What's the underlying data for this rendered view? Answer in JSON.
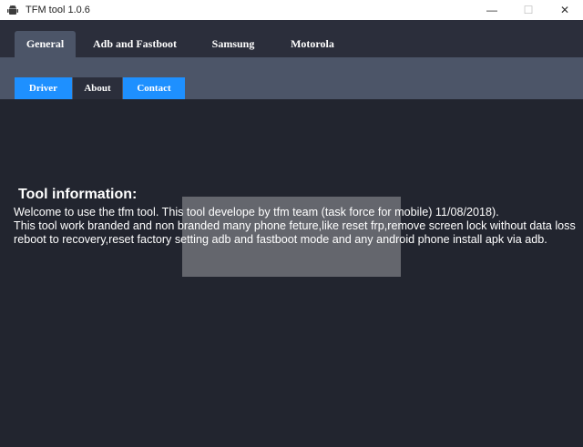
{
  "window": {
    "title": "TFM tool 1.0.6",
    "minimize_label": "—",
    "maximize_label": "☐",
    "close_label": "✕"
  },
  "main_tabs": [
    {
      "label": "General",
      "active": true
    },
    {
      "label": "Adb and Fastboot",
      "active": false
    },
    {
      "label": "Samsung",
      "active": false
    },
    {
      "label": "Motorola",
      "active": false
    }
  ],
  "sub_tabs": [
    {
      "label": "Driver",
      "active": false
    },
    {
      "label": "About",
      "active": true
    },
    {
      "label": "Contact",
      "active": false
    }
  ],
  "about": {
    "heading": "Tool information:",
    "lines": [
      "Welcome to use the tfm tool. This tool develope by tfm team (task force for mobile) 11/08/2018).",
      "This tool work branded and non branded many phone feture,like reset frp,remove screen lock without data loss",
      "reboot to recovery,reset factory setting adb and fastboot mode and any android phone install apk via adb."
    ]
  },
  "colors": {
    "tab_bar": "#2b2e3b",
    "active_tab": "#4c5568",
    "sub_tab_blue": "#1e90ff",
    "content_bg": "#22252f"
  }
}
